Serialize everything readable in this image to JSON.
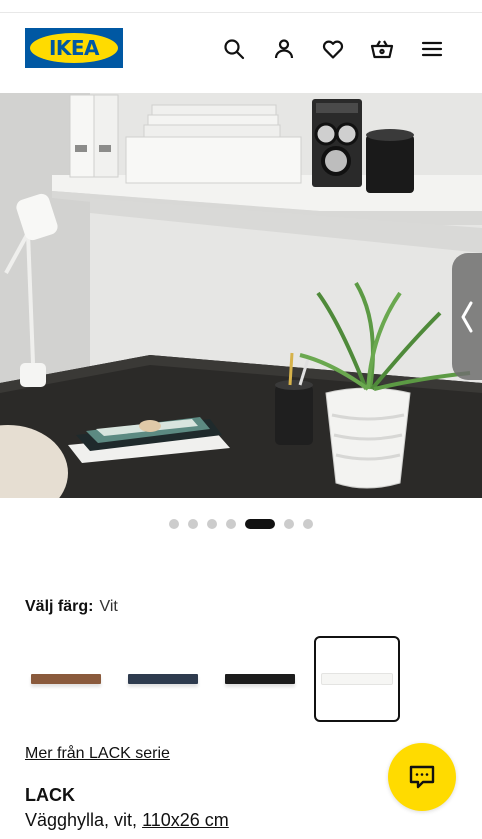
{
  "header": {
    "logo_text": "IKEA",
    "icons": [
      "search-icon",
      "user-icon",
      "heart-icon",
      "basket-icon",
      "menu-icon"
    ]
  },
  "gallery": {
    "image_count": 7,
    "active_index": 4,
    "next_icon": "chevron-right-icon"
  },
  "color_picker": {
    "label": "Välj färg:",
    "selected_value": "Vit",
    "swatches": [
      {
        "color": "#8a5a3c",
        "selected": false
      },
      {
        "color": "#2e3b4e",
        "selected": false
      },
      {
        "color": "#1c1c1c",
        "selected": false
      },
      {
        "color": "#f6f6f4",
        "selected": true
      }
    ]
  },
  "series_link": "Mer från LACK serie",
  "product": {
    "name": "LACK",
    "description": "Vägghylla, vit,",
    "size": "110x26 cm"
  },
  "chat": {
    "icon": "chat-icon"
  },
  "colors": {
    "brand_blue": "#0058a3",
    "brand_yellow": "#ffdb00"
  }
}
